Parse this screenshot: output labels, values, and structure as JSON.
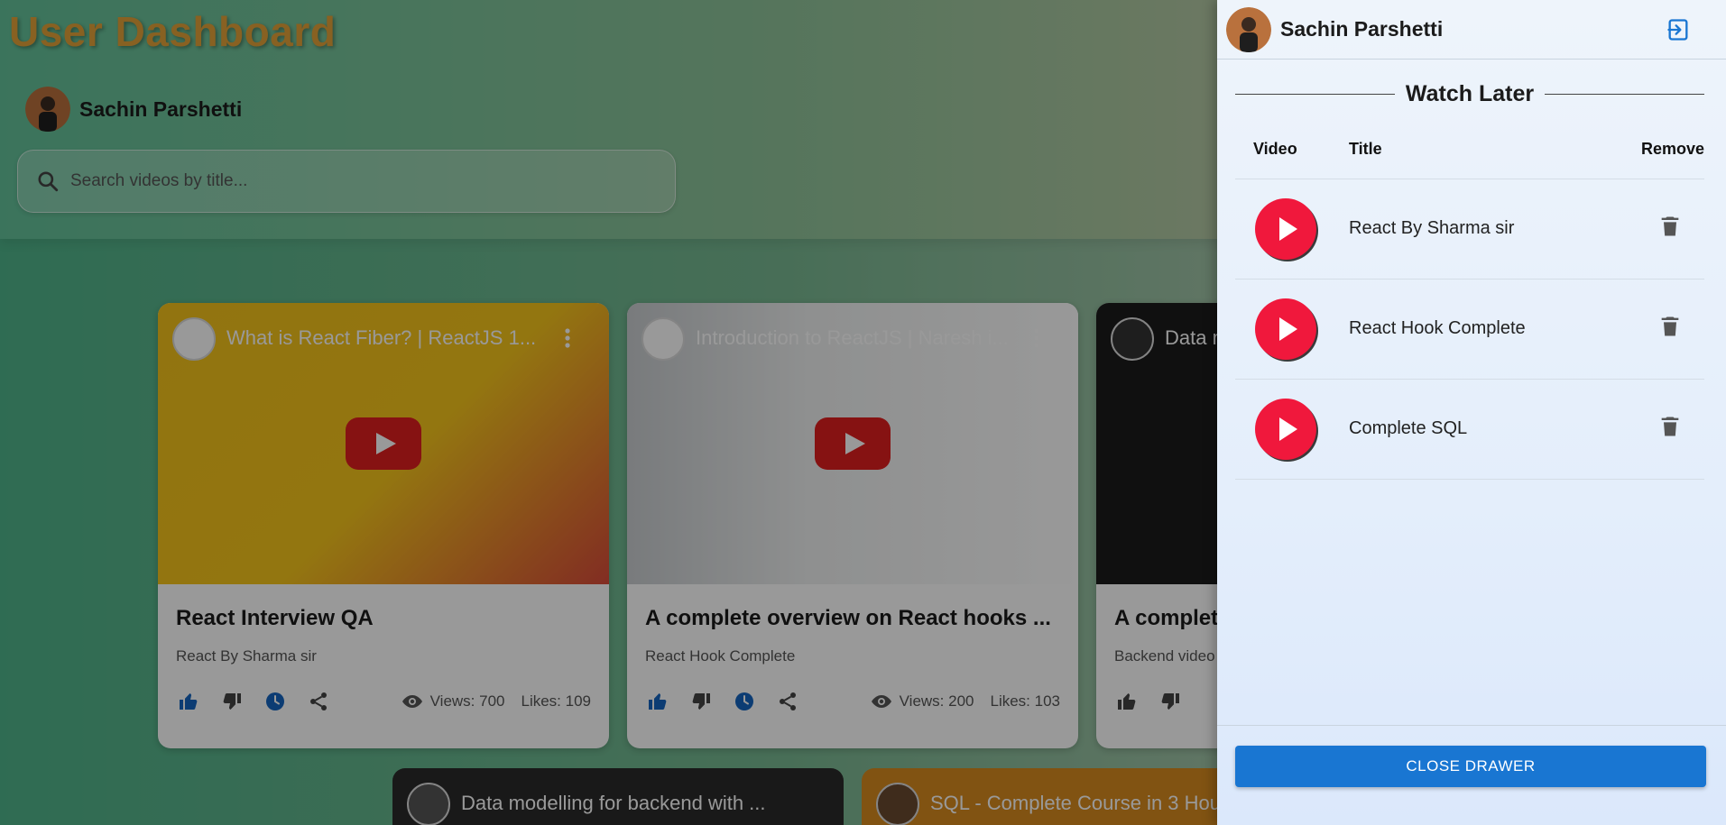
{
  "dashboard": {
    "title": "User Dashboard",
    "user_name": "Sachin Parshetti",
    "search_placeholder": "Search videos by title..."
  },
  "videos": [
    {
      "thumb_title": "What is React Fiber? | ReactJS 1...",
      "title": "React Interview QA",
      "channel": "React By Sharma sir",
      "views": "Views: 700",
      "likes": "Likes: 109"
    },
    {
      "thumb_title": "Introduction to ReactJS | Naresh i...",
      "title": "A complete overview on React hooks ...",
      "channel": "React Hook Complete",
      "views": "Views: 200",
      "likes": "Likes: 103"
    },
    {
      "thumb_title": "Data m",
      "title": "A complet",
      "channel": "Backend video"
    }
  ],
  "bottom_videos": [
    {
      "thumb_title": "Data modelling for backend with ..."
    },
    {
      "thumb_title": "SQL - Complete Course in 3 Hou"
    }
  ],
  "drawer": {
    "user_name": "Sachin Parshetti",
    "heading": "Watch Later",
    "columns": {
      "video": "Video",
      "title": "Title",
      "remove": "Remove"
    },
    "items": [
      {
        "title": "React By Sharma sir"
      },
      {
        "title": "React Hook Complete"
      },
      {
        "title": "Complete SQL"
      }
    ],
    "close_label": "CLOSE DRAWER"
  },
  "colors": {
    "accent": "#1976d2",
    "title_orange": "#e3a23a",
    "youtube_red": "#f0183c"
  },
  "icons": [
    "search-icon",
    "like-icon",
    "dislike-icon",
    "watch-later-icon",
    "share-icon",
    "eye-icon",
    "logout-icon",
    "trash-icon",
    "youtube-icon",
    "more-vert-icon"
  ]
}
